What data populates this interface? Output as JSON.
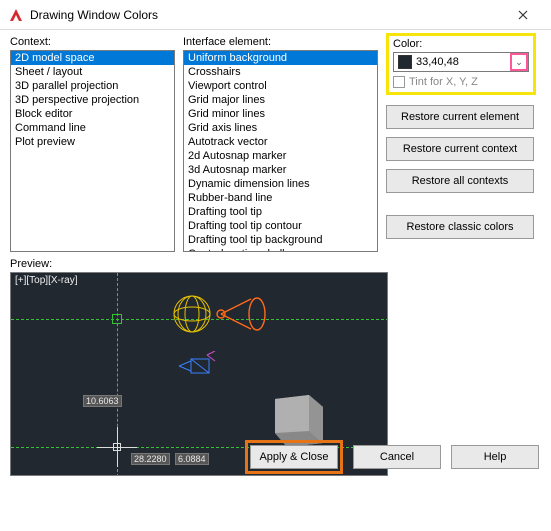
{
  "title": "Drawing Window Colors",
  "labels": {
    "context": "Context:",
    "interface": "Interface element:",
    "color": "Color:",
    "tint": "Tint for X, Y, Z",
    "preview": "Preview:"
  },
  "context_items": [
    "2D model space",
    "Sheet / layout",
    "3D parallel projection",
    "3D perspective projection",
    "Block editor",
    "Command line",
    "Plot preview"
  ],
  "context_selected": 0,
  "interface_items": [
    "Uniform background",
    "Crosshairs",
    "Viewport control",
    "Grid major lines",
    "Grid minor lines",
    "Grid axis lines",
    "Autotrack vector",
    "2d Autosnap marker",
    "3d Autosnap marker",
    "Dynamic dimension lines",
    "Rubber-band line",
    "Drafting tool tip",
    "Drafting tool tip contour",
    "Drafting tool tip background",
    "Control vertices hull"
  ],
  "interface_selected": 0,
  "color_value": "33,40,48",
  "color_swatch": "#212830",
  "buttons": {
    "restore_element": "Restore current element",
    "restore_context": "Restore current context",
    "restore_all": "Restore all contexts",
    "restore_classic": "Restore classic colors",
    "apply_close": "Apply & Close",
    "cancel": "Cancel",
    "help": "Help"
  },
  "preview": {
    "corner_text": "[+][Top][X-ray]",
    "coord1": "10.6063",
    "coord2": "28.2280",
    "coord3": "6.0884"
  }
}
